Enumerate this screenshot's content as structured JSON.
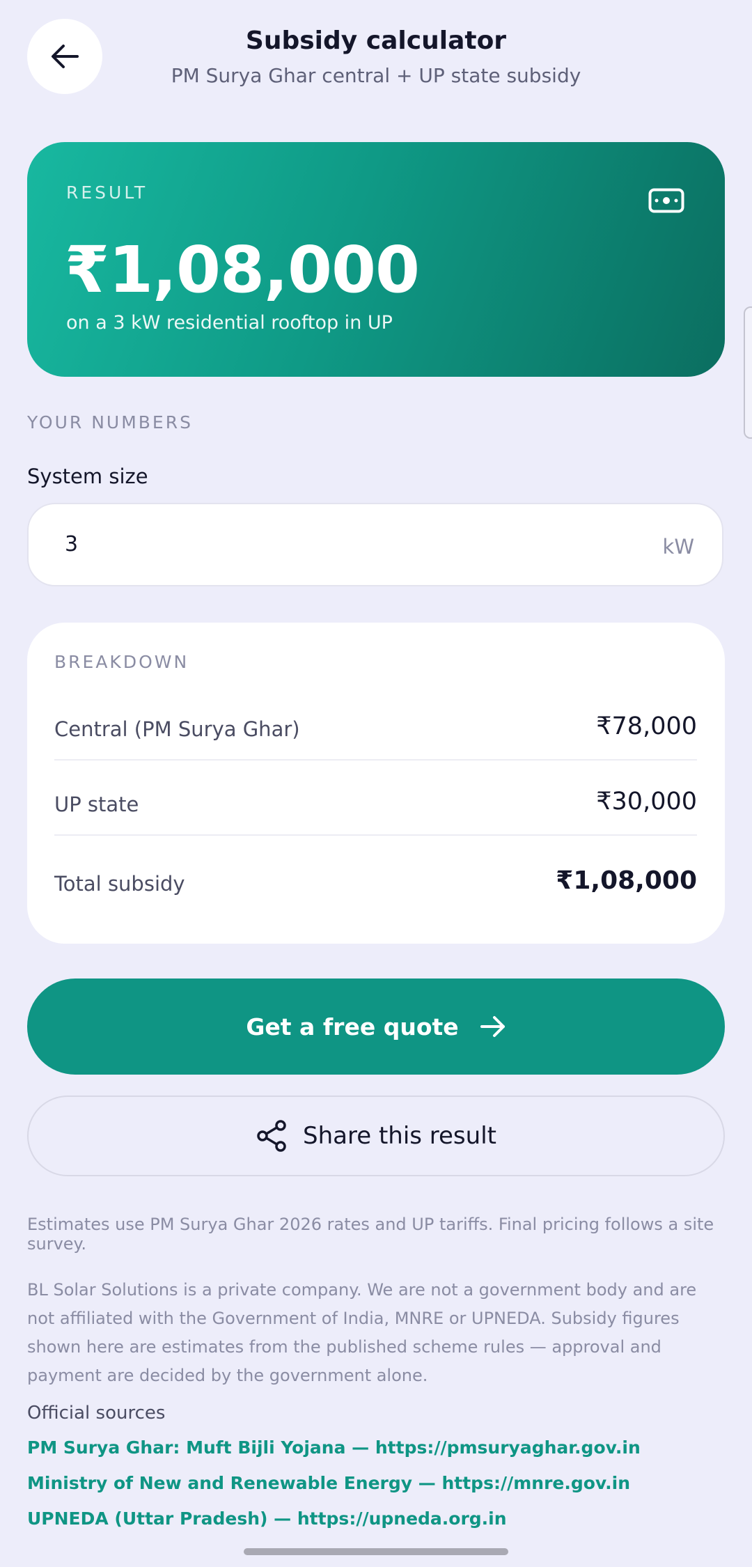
{
  "header": {
    "title": "Subsidy calculator",
    "subtitle": "PM Surya Ghar central + UP state subsidy",
    "back_icon": "arrow-left-icon"
  },
  "result": {
    "label": "RESULT",
    "amount": "₹1,08,000",
    "note": "on a 3 kW residential rooftop in UP",
    "icon": "banknote-icon"
  },
  "inputs": {
    "section_label": "YOUR NUMBERS",
    "system_size_label": "System size",
    "system_size_value": "3",
    "system_size_unit": "kW"
  },
  "breakdown": {
    "title": "BREAKDOWN",
    "rows": [
      {
        "label": "Central (PM Surya Ghar)",
        "value": "₹78,000"
      },
      {
        "label": "UP state",
        "value": "₹30,000"
      },
      {
        "label": "Total subsidy",
        "value": "₹1,08,000"
      }
    ]
  },
  "actions": {
    "quote_label": "Get a free quote",
    "share_label": "Share this result"
  },
  "footer": {
    "estimate_note": "Estimates use PM Surya Ghar 2026 rates and UP tariffs. Final pricing follows a site survey.",
    "disclaimer": "BL Solar Solutions is a private company. We are not a government body and are not affiliated with the Government of India, MNRE or UPNEDA. Subsidy figures shown here are estimates from the published scheme rules — approval and payment are decided by the government alone.",
    "sources_title": "Official sources",
    "sources": [
      "PM Surya Ghar: Muft Bijli Yojana — https://pmsuryaghar.gov.in",
      "Ministry of New and Renewable Energy — https://mnre.gov.in",
      "UPNEDA (Uttar Pradesh) — https://upneda.org.in"
    ]
  },
  "colors": {
    "accent": "#0f9584",
    "background": "#ededfa"
  }
}
